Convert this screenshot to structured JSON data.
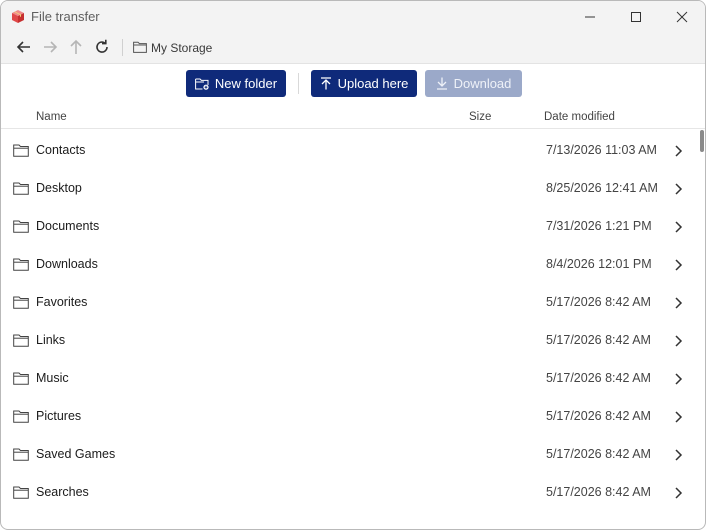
{
  "window": {
    "title": "File transfer",
    "app_icon": "box-icon"
  },
  "titlebar_buttons": [
    "minimize-icon",
    "maximize-icon",
    "close-icon"
  ],
  "nav": {
    "icons": [
      "back-arrow-icon",
      "forward-arrow-icon",
      "up-arrow-icon",
      "refresh-icon"
    ],
    "breadcrumb": "My Storage"
  },
  "toolbar": {
    "new_folder": "New folder",
    "upload": "Upload here",
    "download": "Download"
  },
  "columns": {
    "name": "Name",
    "size": "Size",
    "date": "Date modified"
  },
  "files": [
    {
      "name": "Contacts",
      "size": "",
      "date": "7/13/2026 11:03 AM"
    },
    {
      "name": "Desktop",
      "size": "",
      "date": "8/25/2026 12:41 AM"
    },
    {
      "name": "Documents",
      "size": "",
      "date": "7/31/2026 1:21 PM"
    },
    {
      "name": "Downloads",
      "size": "",
      "date": "8/4/2026 12:01 PM"
    },
    {
      "name": "Favorites",
      "size": "",
      "date": "5/17/2026 8:42 AM"
    },
    {
      "name": "Links",
      "size": "",
      "date": "5/17/2026 8:42 AM"
    },
    {
      "name": "Music",
      "size": "",
      "date": "5/17/2026 8:42 AM"
    },
    {
      "name": "Pictures",
      "size": "",
      "date": "5/17/2026 8:42 AM"
    },
    {
      "name": "Saved Games",
      "size": "",
      "date": "5/17/2026 8:42 AM"
    },
    {
      "name": "Searches",
      "size": "",
      "date": "5/17/2026 8:42 AM"
    }
  ],
  "colors": {
    "primary_button": "#0f2a7a",
    "disabled_button": "#9ba9c9",
    "titlebar_bg": "#f3f3f3"
  }
}
